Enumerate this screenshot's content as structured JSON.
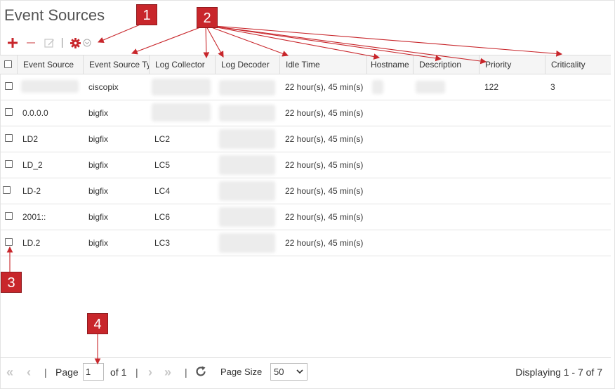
{
  "page": {
    "title": "Event Sources"
  },
  "toolbar": {
    "add": "add-icon",
    "remove": "remove-icon",
    "edit": "edit-icon",
    "settings": "gear-icon",
    "settings_menu": "chevron-down-icon"
  },
  "table": {
    "columns": [
      "Event Source",
      "Event Source Ty",
      "Log Collector",
      "Log Decoder",
      "Idle Time",
      "Hostname",
      "Description",
      "Priority",
      "Criticality"
    ],
    "rows": [
      {
        "event_source": "",
        "type": "ciscopix",
        "log_collector": "",
        "log_decoder": "",
        "idle_time": "22 hour(s), 45 min(s)",
        "hostname": "",
        "description": "",
        "priority": "122",
        "criticality": "3"
      },
      {
        "event_source": "0.0.0.0",
        "type": "bigfix",
        "log_collector": "",
        "log_decoder": "",
        "idle_time": "22 hour(s), 45 min(s)",
        "hostname": "",
        "description": "",
        "priority": "",
        "criticality": ""
      },
      {
        "event_source": "LD2",
        "type": "bigfix",
        "log_collector": "LC2",
        "log_decoder": "",
        "idle_time": "22 hour(s), 45 min(s)",
        "hostname": "",
        "description": "",
        "priority": "",
        "criticality": ""
      },
      {
        "event_source": "LD_2",
        "type": "bigfix",
        "log_collector": "LC5",
        "log_decoder": "",
        "idle_time": "22 hour(s), 45 min(s)",
        "hostname": "",
        "description": "",
        "priority": "",
        "criticality": ""
      },
      {
        "event_source": "LD-2",
        "type": "bigfix",
        "log_collector": "LC4",
        "log_decoder": "",
        "idle_time": "22 hour(s), 45 min(s)",
        "hostname": "",
        "description": "",
        "priority": "",
        "criticality": ""
      },
      {
        "event_source": "2001::",
        "type": "bigfix",
        "log_collector": "LC6",
        "log_decoder": "",
        "idle_time": "22 hour(s), 45 min(s)",
        "hostname": "",
        "description": "",
        "priority": "",
        "criticality": ""
      },
      {
        "event_source": "LD.2",
        "type": "bigfix",
        "log_collector": "LC3",
        "log_decoder": "",
        "idle_time": "22 hour(s), 45 min(s)",
        "hostname": "",
        "description": "",
        "priority": "",
        "criticality": ""
      }
    ]
  },
  "pager": {
    "first": "«",
    "prev": "‹",
    "sep": "|",
    "page_label": "Page",
    "page_value": "1",
    "of_label": "of 1",
    "next": "›",
    "last": "»",
    "refresh": "refresh-icon",
    "page_size_label": "Page Size",
    "page_size_value": "50",
    "displaying": "Displaying 1 - 7 of 7"
  },
  "annotations": [
    "1",
    "2",
    "3",
    "4"
  ],
  "colors": {
    "accent": "#c8262b",
    "disabled": "#c8c8c8",
    "header_bg": "#f5f5f5"
  }
}
